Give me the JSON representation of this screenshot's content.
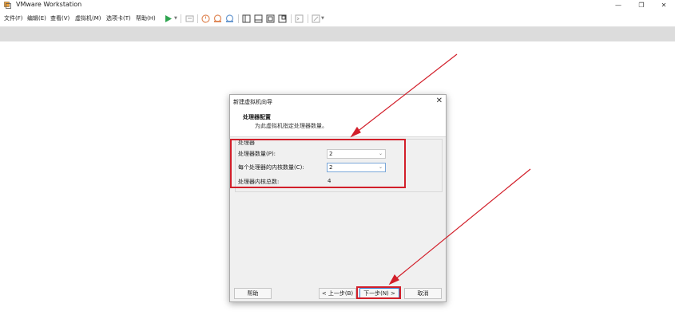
{
  "window": {
    "title": "VMware Workstation",
    "controls": {
      "minimize": "—",
      "restore": "❐",
      "close": "✕"
    }
  },
  "menu": [
    {
      "label": "文件(F)"
    },
    {
      "label": "编辑(E)"
    },
    {
      "label": "查看(V)"
    },
    {
      "label": "虚拟机(M)"
    },
    {
      "label": "选项卡(T)"
    },
    {
      "label": "帮助(H)"
    }
  ],
  "toolbar": {
    "icons": [
      "play-icon",
      "send-keys-icon",
      "snapshot-icon",
      "revert-snapshot-icon",
      "snapshot-manager-icon",
      "sidebar-view-icon",
      "console-view-icon",
      "fullscreen-icon",
      "unity-icon",
      "terminal-icon",
      "autofit-icon"
    ],
    "accent": "#2ea44f"
  },
  "dialog": {
    "title": "新建虚拟机向导",
    "close": "✕",
    "header_title": "处理器配置",
    "header_subtitle": "为此虚拟机指定处理器数量。",
    "group_label": "处理器",
    "processors": {
      "label": "处理器数量(P):",
      "value": "2"
    },
    "cores": {
      "label": "每个处理器的内核数量(C):",
      "value": "2"
    },
    "total": {
      "label": "处理器内核总数:",
      "value": "4"
    },
    "buttons": {
      "help": "帮助",
      "back": "< 上一步(B)",
      "next": "下一步(N) >",
      "cancel": "取消"
    }
  },
  "annotation_color": "#d21f2a"
}
